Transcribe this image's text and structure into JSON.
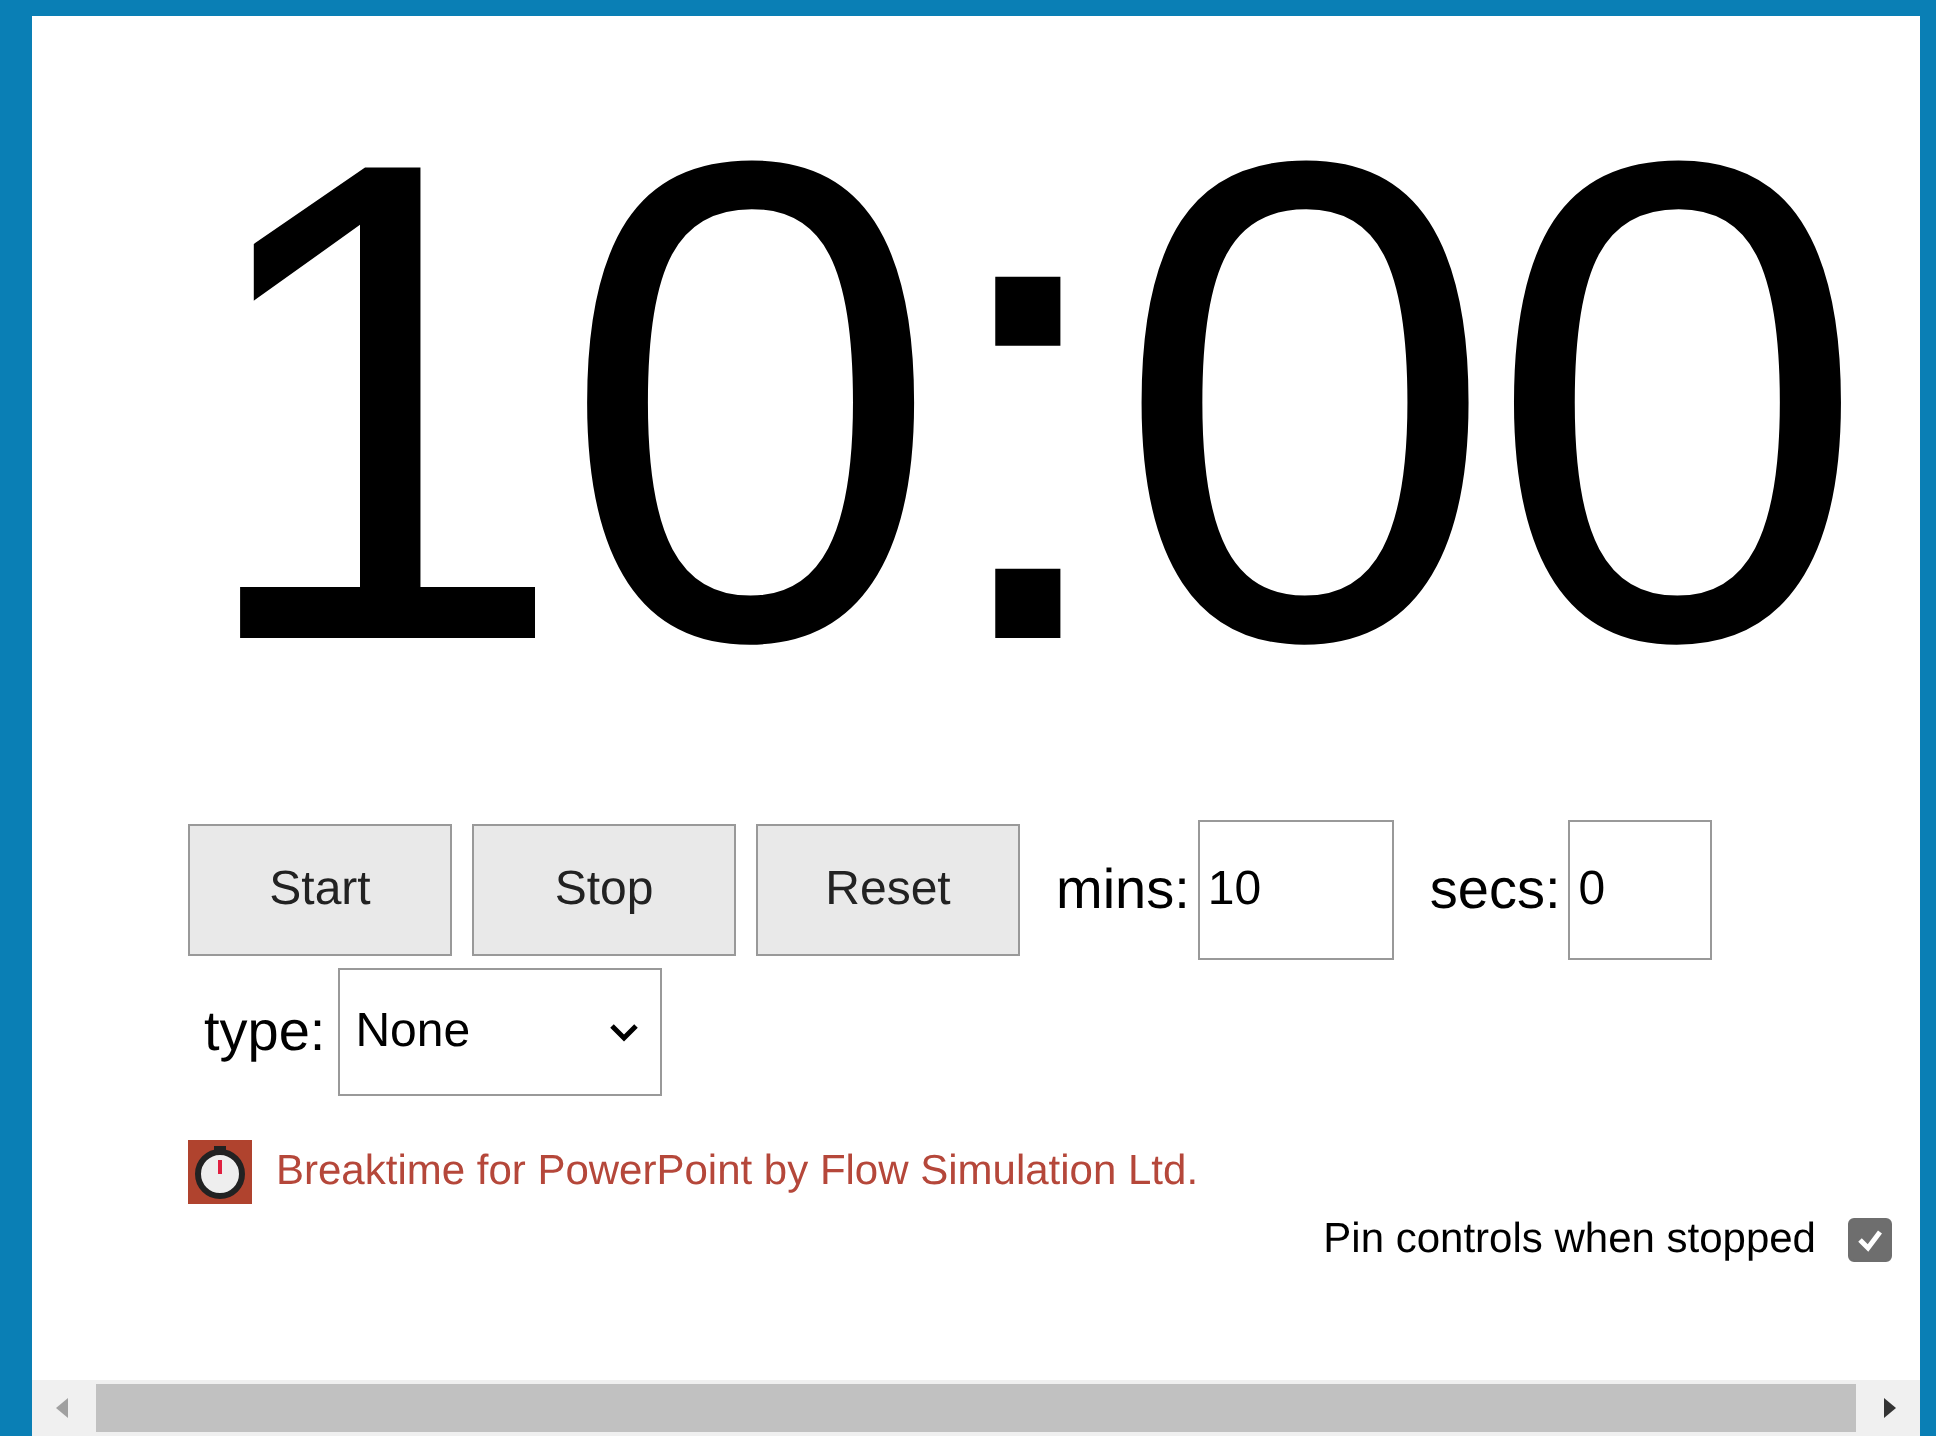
{
  "timer": {
    "display": "10:00"
  },
  "buttons": [
    "Start",
    "Stop",
    "Reset"
  ],
  "fields": [
    {
      "label": "mins:",
      "value": "10"
    },
    {
      "label": "secs:",
      "value": "0"
    }
  ],
  "type": {
    "label": "type:",
    "value": "None"
  },
  "credit": {
    "text": "Breaktime for PowerPoint by Flow Simulation Ltd."
  },
  "pin": {
    "label": "Pin controls when stopped",
    "checked": true
  }
}
